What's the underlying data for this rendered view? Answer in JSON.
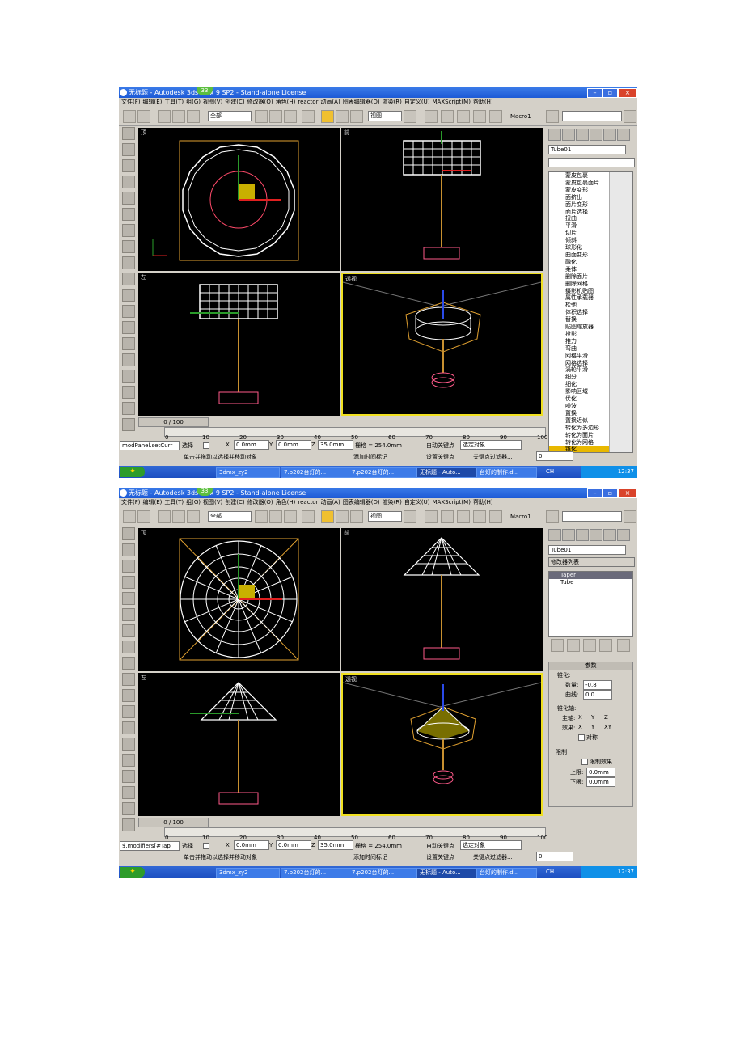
{
  "shot1": {
    "window_title": "无标题 - Autodesk 3ds Max 9 SP2 - Stand-alone License",
    "title_badge": "33",
    "menus": [
      "文件(F)",
      "编辑(E)",
      "工具(T)",
      "组(G)",
      "视图(V)",
      "创建(C)",
      "修改器(O)",
      "角色(H)",
      "reactor",
      "动画(A)",
      "图表编辑器(D)",
      "渲染(R)",
      "自定义(U)",
      "MAXScript(M)",
      "帮助(H)"
    ],
    "selection_filter": "全部",
    "view_dropdown": "视图",
    "macro_label": "Macro1",
    "viewports": {
      "top": "顶",
      "front": "前",
      "left": "左",
      "perspective": "透视"
    },
    "object_name": "Tube01",
    "modifier_list": [
      "蒙皮包裹",
      "蒙皮包裹面片",
      "蒙皮变形",
      "面挤出",
      "面片变形",
      "面片选择",
      "扭曲",
      "平滑",
      "切片",
      "倾斜",
      "球形化",
      "曲面变形",
      "融化",
      "柔体",
      "删除面片",
      "删除网格",
      "摄影机贴图",
      "属性承载器",
      "松弛",
      "体积选择",
      "替换",
      "贴图缩放器",
      "投影",
      "推力",
      "弯曲",
      "网格平滑",
      "网格选择",
      "涡轮平滑",
      "细分",
      "细化",
      "影响区域",
      "优化",
      "噪波",
      "置换",
      "置换近似",
      "转化为多边形",
      "转化为面片",
      "转化为网格",
      "锥化"
    ],
    "selected_modifier": "锥化",
    "frame_slider": "0 / 100",
    "ruler_ticks": [
      "0",
      "10",
      "20",
      "30",
      "40",
      "50",
      "60",
      "70",
      "80",
      "90",
      "100"
    ],
    "maxscript_listener": "modPanel.setCurr",
    "status_select": "选择",
    "x_label": "X",
    "x_value": "0.0mm",
    "y_label": "Y",
    "y_value": "0.0mm",
    "z_label": "Z",
    "z_value": "35.0mm",
    "grid_text": "栅格 = 254.0mm",
    "auto_key": "自动关键点",
    "selected_objects": "选定对象",
    "prompt": "单击并拖动以选择并移动对象",
    "add_time_tag": "添加时间标记",
    "set_key": "设置关键点",
    "key_filters": "关键点过滤器...",
    "frame_value": "0",
    "taskbar": [
      "3dmx_zy2",
      "7.p202台灯的...",
      "7.p202台灯的...",
      "无标题 - Auto...",
      "台灯的制作.d..."
    ],
    "tray_lang": "CH",
    "clock": "12:37"
  },
  "shot2": {
    "window_title": "无标题 - Autodesk 3ds Max 9 SP2 - Stand-alone License",
    "title_badge": "33",
    "object_name": "Tube01",
    "modifier_list_dropdown": "修改器列表",
    "stack": [
      "Taper",
      "Tube"
    ],
    "params_header": "参数",
    "taper_group": "锥化:",
    "amount_label": "数量:",
    "amount_value": "-0.8",
    "curve_label": "曲线:",
    "curve_value": "0.0",
    "axis_group": "锥化轴:",
    "primary_label": "主轴:",
    "primary_axes": [
      "X",
      "Y",
      "Z"
    ],
    "primary_selected": "Z",
    "effect_label": "效果:",
    "effect_axes": [
      "X",
      "Y",
      "XY"
    ],
    "effect_selected": "XY",
    "symmetry_label": "对称",
    "limits_group": "限制",
    "limit_effect_label": "限制效果",
    "upper_label": "上限:",
    "upper_value": "0.0mm",
    "lower_label": "下限:",
    "lower_value": "0.0mm",
    "maxscript_listener": "$.modifiers[#Tap",
    "clock": "12:37"
  }
}
